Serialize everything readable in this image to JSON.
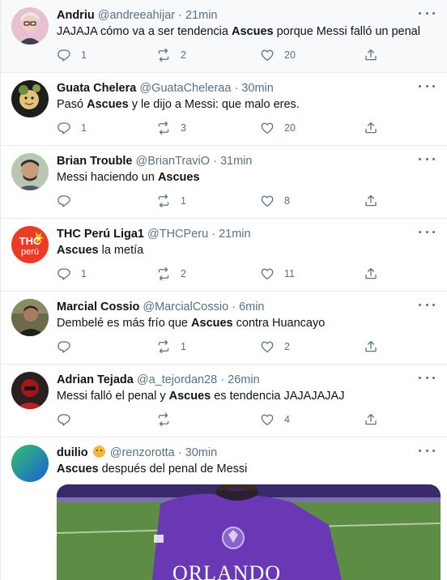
{
  "tweets": [
    {
      "name": "Andriu",
      "handle": "@andreeahijar",
      "time": "21min",
      "text_parts": [
        {
          "t": "JAJAJA cómo va a ser tendencia ",
          "b": false
        },
        {
          "t": "Ascues",
          "b": true
        },
        {
          "t": " porque Messi falló un penal",
          "b": false
        }
      ],
      "replies": "1",
      "retweets": "2",
      "likes": "20"
    },
    {
      "name": "Guata Chelera",
      "handle": "@GuataCheleraa",
      "time": "30min",
      "text_parts": [
        {
          "t": "Pasó ",
          "b": false
        },
        {
          "t": "Ascues",
          "b": true
        },
        {
          "t": " y le dijo a Messi: que malo eres.",
          "b": false
        }
      ],
      "replies": "1",
      "retweets": "3",
      "likes": "20"
    },
    {
      "name": "Brian Trouble",
      "handle": "@BrianTraviO",
      "time": "31min",
      "text_parts": [
        {
          "t": "Messi haciendo un ",
          "b": false
        },
        {
          "t": "Ascues",
          "b": true
        }
      ],
      "replies": "",
      "retweets": "1",
      "likes": "8"
    },
    {
      "name": "THC Perú Liga1",
      "handle": "@THCPeru",
      "time": "21min",
      "text_parts": [
        {
          "t": "Ascues",
          "b": true
        },
        {
          "t": " la metía",
          "b": false
        }
      ],
      "replies": "1",
      "retweets": "2",
      "likes": "11"
    },
    {
      "name": "Marcial Cossio",
      "handle": "@MarcialCossio",
      "time": "6min",
      "text_parts": [
        {
          "t": "Dembelé es más frío que ",
          "b": false
        },
        {
          "t": "Ascues",
          "b": true
        },
        {
          "t": " contra Huancayo",
          "b": false
        }
      ],
      "replies": "",
      "retweets": "1",
      "likes": "2"
    },
    {
      "name": "Adrian Tejada",
      "handle": "@a_tejordan28",
      "time": "26min",
      "text_parts": [
        {
          "t": "Messi falló el penal y ",
          "b": false
        },
        {
          "t": "Ascues",
          "b": true
        },
        {
          "t": " es tendencia JAJAJAJAJ",
          "b": false
        }
      ],
      "replies": "",
      "retweets": "",
      "likes": "4"
    },
    {
      "name": "duilio",
      "handle": "@renzorotta",
      "time": "30min",
      "text_parts": [
        {
          "t": "Ascues",
          "b": true
        },
        {
          "t": " después del penal de Messi",
          "b": false
        }
      ],
      "has_emoji": true,
      "emoji_icon": "thinking-face-icon",
      "media": {
        "jersey_text": "ORLANDO"
      }
    }
  ],
  "thc_avatar_text": [
    "THC",
    "perú"
  ],
  "colors": {
    "meta": "#5b7083",
    "divider": "#e6ecf0",
    "highlight": "#f7f9fa",
    "jersey": "#6a38b5"
  }
}
